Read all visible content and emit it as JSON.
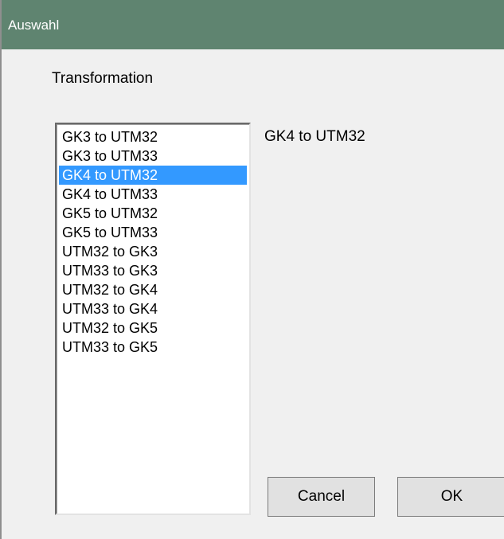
{
  "window": {
    "title": "Auswahl"
  },
  "group": {
    "label": "Transformation"
  },
  "list": {
    "items": [
      {
        "label": "GK3 to UTM32",
        "selected": false
      },
      {
        "label": "GK3 to UTM33",
        "selected": false
      },
      {
        "label": "GK4 to UTM32",
        "selected": true
      },
      {
        "label": "GK4 to UTM33",
        "selected": false
      },
      {
        "label": "GK5 to UTM32",
        "selected": false
      },
      {
        "label": "GK5 to UTM33",
        "selected": false
      },
      {
        "label": "UTM32 to GK3",
        "selected": false
      },
      {
        "label": "UTM33 to GK3",
        "selected": false
      },
      {
        "label": "UTM32 to GK4",
        "selected": false
      },
      {
        "label": "UTM33 to GK4",
        "selected": false
      },
      {
        "label": "UTM32 to GK5",
        "selected": false
      },
      {
        "label": "UTM33 to GK5",
        "selected": false
      }
    ]
  },
  "selection": {
    "value": "GK4 to UTM32"
  },
  "buttons": {
    "cancel_label": "Cancel",
    "ok_label": "OK"
  },
  "colors": {
    "titlebar": "#5f8470",
    "selection_highlight": "#3399ff",
    "dialog_background": "#f0f0f0"
  }
}
